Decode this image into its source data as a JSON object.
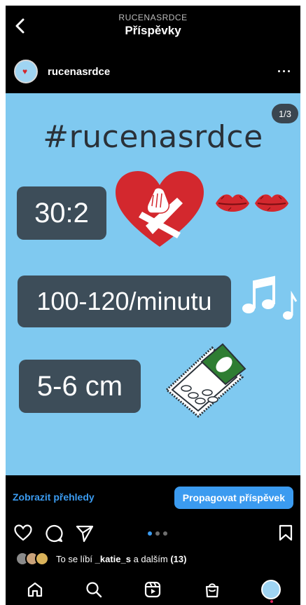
{
  "header": {
    "account_caps": "RUCENASRDCE",
    "title": "Příspěvky"
  },
  "post": {
    "username": "rucenasrdce",
    "more_label": "···",
    "image": {
      "counter": "1/3",
      "hashtag": "#rucenasrdce",
      "ratio_text": "30:2",
      "rate_text": "100-120/minutu",
      "depth_text": "5-6 cm"
    }
  },
  "actions": {
    "insights_label": "Zobrazit přehledy",
    "promote_label": "Propagovat příspěvek",
    "carousel_total": 3,
    "carousel_active": 1
  },
  "likes": {
    "prefix": "To se líbí ",
    "user": "_katie_s",
    "middle": " a dalším ",
    "count": "(13)"
  },
  "colors": {
    "image_bg": "#7fc9f0",
    "pill_bg": "#3d4d59",
    "accent_blue": "#3b9bf0",
    "heart_red": "#d3282e"
  },
  "icons": {
    "back": "chevron-left-icon",
    "like": "heart-outline-icon",
    "comment": "comment-icon",
    "share": "send-icon",
    "save": "bookmark-icon",
    "nav": [
      "home-icon",
      "search-icon",
      "reels-icon",
      "shop-icon",
      "profile-avatar"
    ]
  }
}
